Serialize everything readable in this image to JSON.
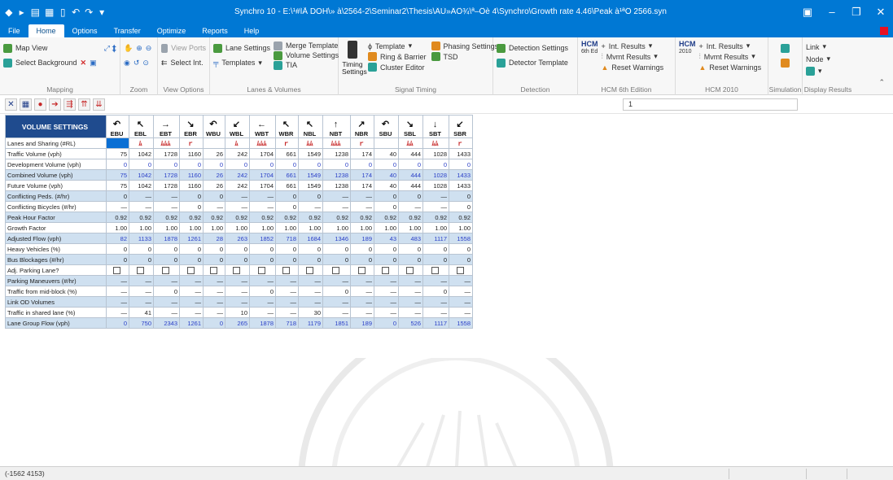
{
  "app": {
    "title": "Synchro 10 - E:\\¹#ÍÅ DOH\\» à\\2564-2\\Seminar2\\Thesis\\ÂÙ»ÂÔ¾\\ª–Ôè 4\\Synchro\\Growth rate 4.46\\Peak à¹ªÔ 2566.syn"
  },
  "tabs": [
    "File",
    "Home",
    "Options",
    "Transfer",
    "Optimize",
    "Reports",
    "Help"
  ],
  "active_tab": "Home",
  "ribbon": {
    "mapping": {
      "label": "Mapping",
      "map_view": "Map View",
      "select_background": "Select Background"
    },
    "zoom": {
      "label": "Zoom"
    },
    "view_options": {
      "label": "View Options",
      "view_ports": "View Ports",
      "select_int": "Select Int."
    },
    "lanes_volumes": {
      "label": "Lanes & Volumes",
      "lane_settings": "Lane Settings",
      "templates": "Templates",
      "merge_template": "Merge Template",
      "volume_settings": "Volume Settings",
      "tia": "TIA"
    },
    "signal_timing": {
      "label": "Signal Timing",
      "timing_settings_1": "Timing",
      "timing_settings_2": "Settings",
      "template": "Template",
      "ring_barrier": "Ring & Barrier",
      "cluster_editor": "Cluster Editor",
      "phasing_settings": "Phasing Settings",
      "tsd": "TSD"
    },
    "detection": {
      "label": "Detection",
      "detection_settings": "Detection Settings",
      "detector_template": "Detector Template"
    },
    "hcm6": {
      "label": "HCM 6th Edition",
      "logo": "HCM",
      "logo_sub": "6th Ed",
      "int_results": "Int. Results",
      "mvmt_results": "Mvmt Results",
      "reset_warnings": "Reset Warnings"
    },
    "hcm2010": {
      "label": "HCM 2010",
      "logo": "HCM",
      "logo_sub": "2010",
      "int_results": "Int. Results",
      "mvmt_results": "Mvmt Results",
      "reset_warnings": "Reset Warnings"
    },
    "simulation": {
      "label": "Simulation"
    },
    "display_results": {
      "label": "Display Results",
      "link": "Link",
      "node": "Node"
    }
  },
  "toolbar": {
    "intersection_field": "1"
  },
  "grid": {
    "title": "VOLUME SETTINGS",
    "movements": [
      "EBU",
      "EBL",
      "EBT",
      "EBR",
      "WBU",
      "WBL",
      "WBT",
      "WBR",
      "NBL",
      "NBT",
      "NBR",
      "SBU",
      "SBL",
      "SBT",
      "SBR"
    ],
    "movement_icons": [
      "↶",
      "↖",
      "→",
      "↘",
      "↶",
      "↙",
      "←",
      "↖",
      "↖",
      "↑",
      "↗",
      "↶",
      "↘",
      "↓",
      "↙"
    ],
    "lanes_label": "Lanes and Sharing (#RL)",
    "lanes": [
      "",
      "",
      "ﾑ",
      "ﾑﾑﾑ",
      "ｒ",
      "",
      "ﾑ",
      "ﾑﾑﾑ",
      "ｒ",
      "ﾑﾑ",
      "ﾑﾑﾑ",
      "ｒ",
      "",
      "ﾑﾑ",
      "ﾑﾑ",
      "ｒ"
    ],
    "rows": [
      {
        "label": "Traffic Volume (vph)",
        "alt": false,
        "color": "dark",
        "values": [
          "75",
          "1042",
          "1728",
          "1160",
          "26",
          "242",
          "1704",
          "661",
          "1549",
          "1238",
          "174",
          "40",
          "444",
          "1028",
          "1433"
        ]
      },
      {
        "label": "Development Volume (vph)",
        "alt": false,
        "color": "blue",
        "values": [
          "0",
          "0",
          "0",
          "0",
          "0",
          "0",
          "0",
          "0",
          "0",
          "0",
          "0",
          "0",
          "0",
          "0",
          "0"
        ]
      },
      {
        "label": "Combined Volume (vph)",
        "alt": true,
        "color": "blue",
        "values": [
          "75",
          "1042",
          "1728",
          "1160",
          "26",
          "242",
          "1704",
          "661",
          "1549",
          "1238",
          "174",
          "40",
          "444",
          "1028",
          "1433"
        ]
      },
      {
        "label": "Future Volume (vph)",
        "alt": false,
        "color": "dark",
        "values": [
          "75",
          "1042",
          "1728",
          "1160",
          "26",
          "242",
          "1704",
          "661",
          "1549",
          "1238",
          "174",
          "40",
          "444",
          "1028",
          "1433"
        ]
      },
      {
        "label": "Conflicting Peds. (#/hr)",
        "alt": true,
        "color": "dark",
        "values": [
          "0",
          "—",
          "—",
          "0",
          "0",
          "—",
          "—",
          "0",
          "0",
          "—",
          "—",
          "0",
          "0",
          "—",
          "0"
        ]
      },
      {
        "label": "Conflicting Bicycles (#/hr)",
        "alt": false,
        "color": "dark",
        "values": [
          "—",
          "—",
          "—",
          "0",
          "—",
          "—",
          "—",
          "0",
          "—",
          "—",
          "—",
          "0",
          "—",
          "—",
          "0"
        ]
      },
      {
        "label": "Peak Hour Factor",
        "alt": true,
        "color": "dark",
        "values": [
          "0.92",
          "0.92",
          "0.92",
          "0.92",
          "0.92",
          "0.92",
          "0.92",
          "0.92",
          "0.92",
          "0.92",
          "0.92",
          "0.92",
          "0.92",
          "0.92",
          "0.92"
        ]
      },
      {
        "label": "Growth Factor",
        "alt": false,
        "color": "dark",
        "values": [
          "1.00",
          "1.00",
          "1.00",
          "1.00",
          "1.00",
          "1.00",
          "1.00",
          "1.00",
          "1.00",
          "1.00",
          "1.00",
          "1.00",
          "1.00",
          "1.00",
          "1.00"
        ]
      },
      {
        "label": "Adjusted Flow (vph)",
        "alt": true,
        "color": "blue",
        "values": [
          "82",
          "1133",
          "1878",
          "1261",
          "28",
          "263",
          "1852",
          "718",
          "1684",
          "1346",
          "189",
          "43",
          "483",
          "1117",
          "1558"
        ]
      },
      {
        "label": "Heavy Vehicles (%)",
        "alt": false,
        "color": "dark",
        "values": [
          "0",
          "0",
          "0",
          "0",
          "0",
          "0",
          "0",
          "0",
          "0",
          "0",
          "0",
          "0",
          "0",
          "0",
          "0"
        ]
      },
      {
        "label": "Bus Blockages (#/hr)",
        "alt": true,
        "color": "dark",
        "values": [
          "0",
          "0",
          "0",
          "0",
          "0",
          "0",
          "0",
          "0",
          "0",
          "0",
          "0",
          "0",
          "0",
          "0",
          "0"
        ]
      },
      {
        "label": "Adj. Parking Lane?",
        "alt": false,
        "color": "checkbox",
        "values": [
          "",
          "",
          "",
          "",
          "",
          "",
          "",
          "",
          "",
          "",
          "",
          "",
          "",
          "",
          ""
        ]
      },
      {
        "label": "Parking Maneuvers (#/hr)",
        "alt": true,
        "color": "dark",
        "values": [
          "—",
          "—",
          "—",
          "—",
          "—",
          "—",
          "—",
          "—",
          "—",
          "—",
          "—",
          "—",
          "—",
          "—",
          "—"
        ]
      },
      {
        "label": "Traffic from mid-block (%)",
        "alt": false,
        "color": "dark",
        "values": [
          "—",
          "—",
          "0",
          "—",
          "—",
          "—",
          "0",
          "—",
          "—",
          "0",
          "—",
          "—",
          "—",
          "0",
          "—"
        ]
      },
      {
        "label": "Link OD Volumes",
        "alt": true,
        "color": "dark",
        "values": [
          "—",
          "—",
          "—",
          "—",
          "—",
          "—",
          "—",
          "—",
          "—",
          "—",
          "—",
          "—",
          "—",
          "—",
          "—"
        ]
      },
      {
        "label": "Traffic in shared lane (%)",
        "alt": false,
        "color": "dark",
        "values": [
          "—",
          "41",
          "—",
          "—",
          "—",
          "10",
          "—",
          "—",
          "30",
          "—",
          "—",
          "—",
          "—",
          "—",
          "—"
        ]
      },
      {
        "label": "Lane Group Flow (vph)",
        "alt": true,
        "color": "blue",
        "values": [
          "0",
          "750",
          "2343",
          "1261",
          "0",
          "265",
          "1878",
          "718",
          "1179",
          "1851",
          "189",
          "0",
          "526",
          "1117",
          "1558"
        ]
      }
    ]
  },
  "status": {
    "coords": "(-1562  4153)"
  }
}
